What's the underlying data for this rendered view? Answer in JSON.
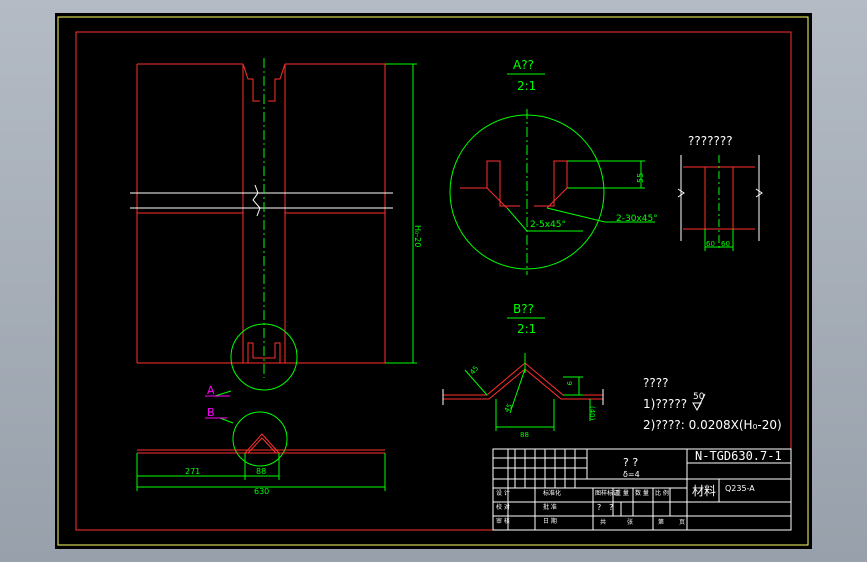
{
  "view_a": {
    "title": "A??",
    "scale": "2:1",
    "dim_55": "55",
    "chamfer_small": "2-5x45°",
    "chamfer_large": "2-30x45°"
  },
  "view_b": {
    "title": "B??",
    "scale": "2:1",
    "dim_88": "88",
    "dim_45": "45",
    "dim_9": "9",
    "dim_40": "(40)",
    "dim_r": "45"
  },
  "detail_c": {
    "title": "???????",
    "dim_60a": "60",
    "dim_60b": "60"
  },
  "main_view": {
    "height_dim": "H₀-20",
    "label_a": "A",
    "label_b": "B"
  },
  "bottom_view": {
    "dim_271": "271",
    "dim_88": "88",
    "dim_630": "630"
  },
  "notes": {
    "heading": "????",
    "line1": "1)?????",
    "roughness": "50",
    "line2": "2)????: 0.0208X(H₀-20)"
  },
  "title_block": {
    "drawing_no": "N-TGD630.7-1",
    "part_name": "?    ?",
    "thickness": "δ=4",
    "material_label": "材料",
    "material": "Q235-A",
    "row_design": "设 计",
    "row_check": "校 对",
    "row_review": "审 核",
    "row_standard": "标准化",
    "row_approve": "批 准",
    "row_date": "日 期",
    "col_stage": "图样标记",
    "col_weight": "重 量",
    "col_qty": "数 量",
    "col_ratio": "比 例",
    "col_total": "共",
    "col_sheet": "张",
    "col_page": "第",
    "col_pageunit": "页",
    "q1": "?",
    "q2": "?"
  }
}
